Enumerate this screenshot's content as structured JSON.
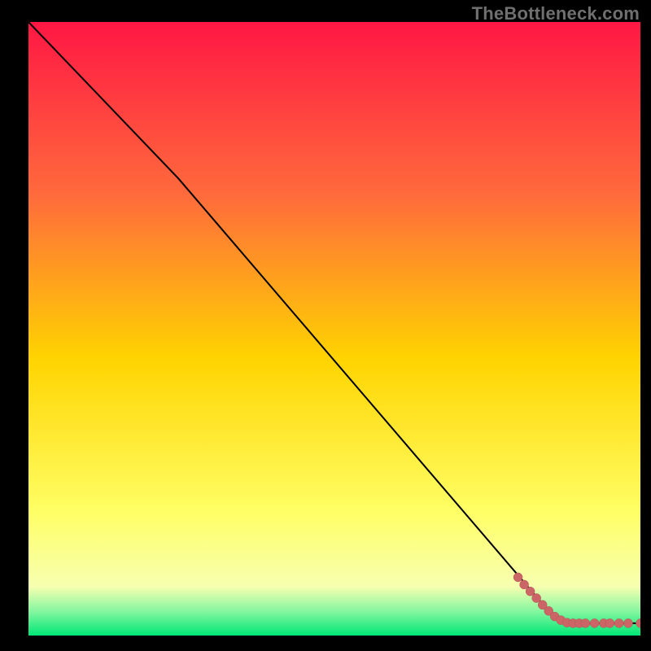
{
  "watermark": "TheBottleneck.com",
  "colors": {
    "frame_bg": "#000000",
    "line": "#000000",
    "dot_fill": "#cc6666",
    "dot_stroke": "#b35454",
    "grad_top": "#ff1744",
    "grad_upper": "#ff6a3c",
    "grad_mid": "#ffd400",
    "grad_yellow_soft": "#ffff66",
    "grad_pale": "#f7ffb0",
    "grad_mint": "#86f7a0",
    "grad_green": "#00e676"
  },
  "chart_data": {
    "type": "line",
    "title": "",
    "xlabel": "",
    "ylabel": "",
    "x_range": [
      0,
      100
    ],
    "y_range": [
      0,
      100
    ],
    "line_points": [
      {
        "x": 0,
        "y": 100
      },
      {
        "x": 24.5,
        "y": 74.5
      },
      {
        "x": 85,
        "y": 4
      },
      {
        "x": 88,
        "y": 2
      },
      {
        "x": 100,
        "y": 2
      }
    ],
    "notes": "Background is a vertical gradient from red (high y) through orange/yellow to a narrow green band at the bottom. A black curve descends from top-left; slope steepens after ~x=25. Coral dots cluster on the curve tail (x≈80–90) and along the flat baseline (y≈2) out to x=100.",
    "scatter_points": [
      {
        "x": 80.0,
        "y": 9.5
      },
      {
        "x": 81.0,
        "y": 8.3
      },
      {
        "x": 82.0,
        "y": 7.2
      },
      {
        "x": 83.0,
        "y": 6.1
      },
      {
        "x": 84.0,
        "y": 5.0
      },
      {
        "x": 85.0,
        "y": 4.0
      },
      {
        "x": 86.0,
        "y": 3.1
      },
      {
        "x": 87.0,
        "y": 2.5
      },
      {
        "x": 88.0,
        "y": 2.1
      },
      {
        "x": 89.0,
        "y": 2.0
      },
      {
        "x": 90.0,
        "y": 2.0
      },
      {
        "x": 91.0,
        "y": 2.0
      },
      {
        "x": 92.5,
        "y": 2.0
      },
      {
        "x": 94.0,
        "y": 2.0
      },
      {
        "x": 95.0,
        "y": 2.0
      },
      {
        "x": 96.5,
        "y": 2.0
      },
      {
        "x": 98.0,
        "y": 2.0
      },
      {
        "x": 100.0,
        "y": 2.0
      }
    ]
  }
}
